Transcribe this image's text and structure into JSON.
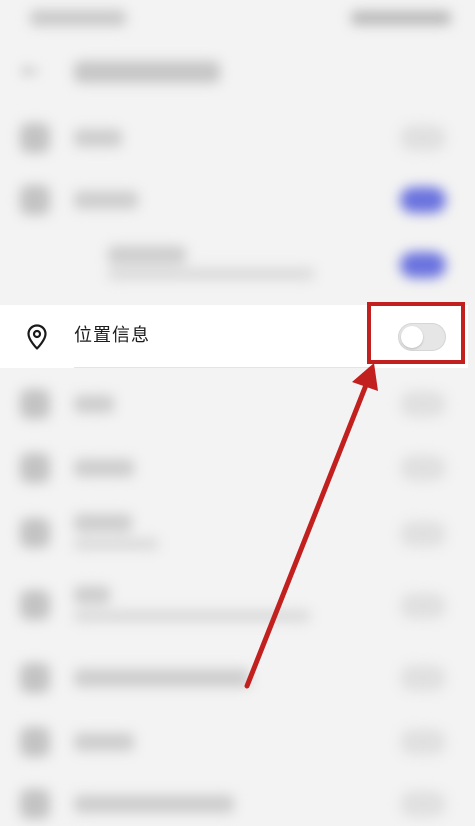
{
  "location_setting": {
    "label": "位置信息",
    "icon": "location-pin-icon",
    "enabled": false
  },
  "annotation": {
    "color": "#c21f1f"
  }
}
